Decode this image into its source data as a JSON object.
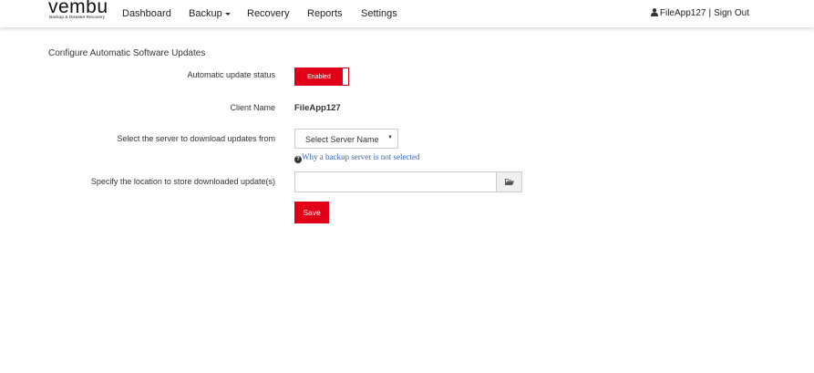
{
  "brand": {
    "logo_text": "vembu",
    "tagline": "Backup & Disaster Recovery",
    "accent_color": "#e20018"
  },
  "nav": {
    "dashboard": "Dashboard",
    "backup": "Backup",
    "recovery": "Recovery",
    "reports": "Reports",
    "settings": "Settings"
  },
  "user": {
    "name": "FileApp127",
    "separator": "|",
    "sign_out": "Sign Out",
    "icon": "user-icon"
  },
  "page": {
    "title": "Configure Automatic Software Updates"
  },
  "form": {
    "status_label": "Automatic update status",
    "status_value": "Enabled",
    "client_label": "Client Name",
    "client_value": "FileApp127",
    "server_label": "Select the server to download updates from",
    "server_select": "Select Server Name",
    "server_help": "Why a backup server is not selected",
    "location_label": "Specify the location to store downloaded update(s)",
    "location_value": "",
    "browse_icon": "folder-open-icon",
    "save_label": "Save"
  }
}
